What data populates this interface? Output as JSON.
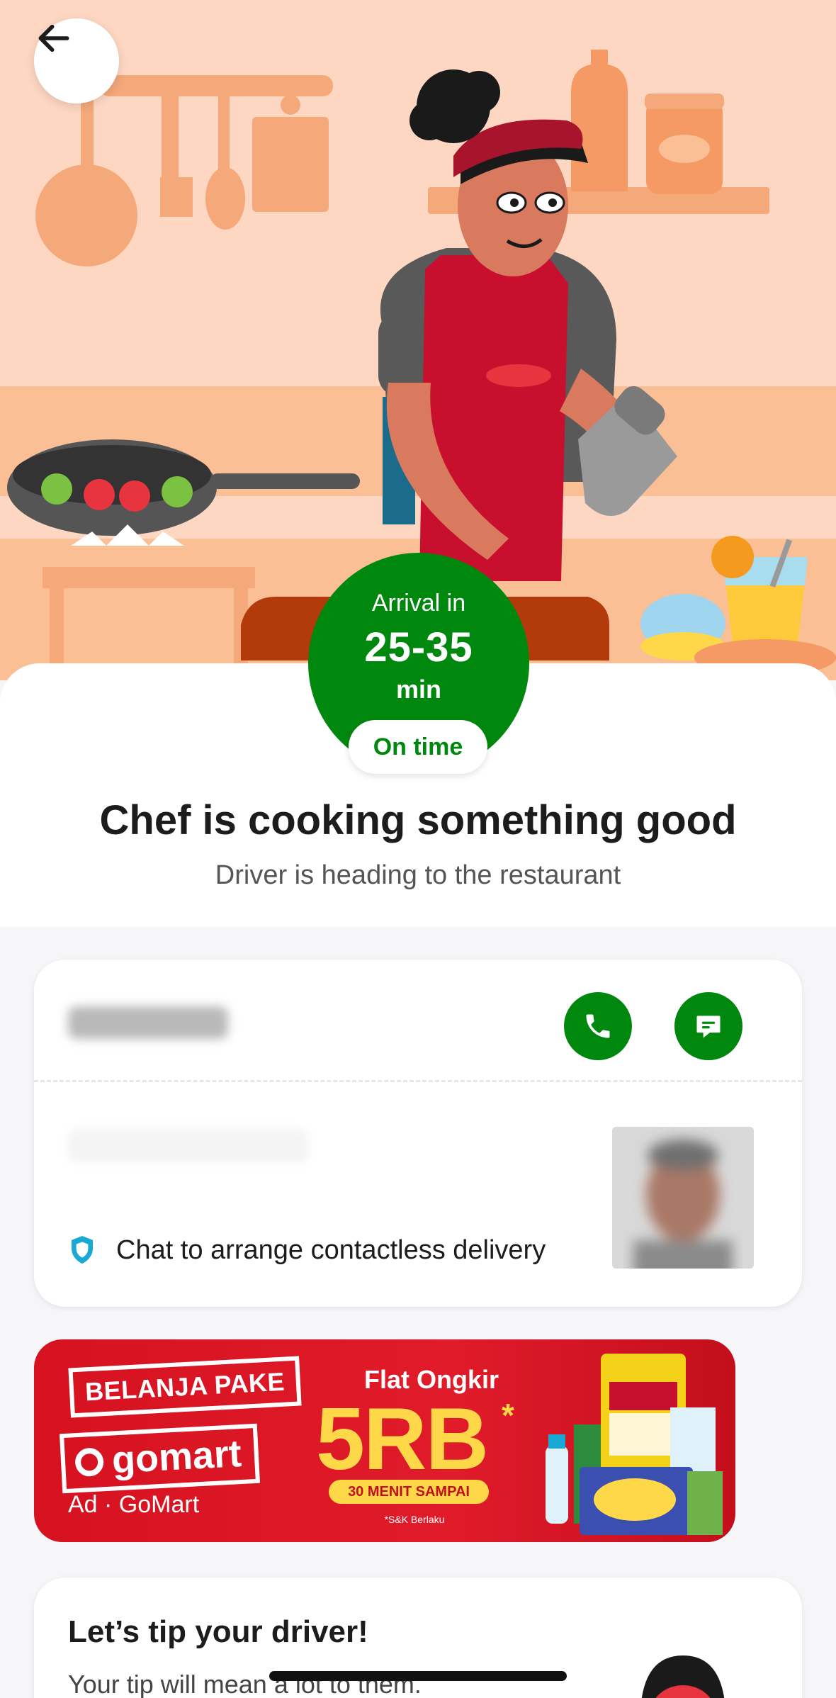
{
  "header": {
    "back_icon": "arrow-left-icon"
  },
  "eta": {
    "label": "Arrival in",
    "value": "25-35",
    "unit": "min",
    "status": "On time"
  },
  "status": {
    "title": "Chef is cooking something good",
    "subtitle": "Driver is heading to the restaurant"
  },
  "driver": {
    "call_icon": "phone-icon",
    "chat_icon": "chat-icon",
    "contactless_icon": "shield-icon",
    "contactless_text": "Chat to arrange contactless delivery"
  },
  "ad": {
    "headline_1": "BELANJA PAKE",
    "brand": "gomart",
    "label": "Ad · GoMart",
    "flat": "Flat Ongkir",
    "price": "5RB",
    "price_star": "*",
    "time_badge": "30 MENIT SAMPAI",
    "terms": "*S&K Berlaku"
  },
  "tip": {
    "title": "Let’s tip your driver!",
    "subtitle": "Your tip will mean a lot to them."
  },
  "colors": {
    "primary_green": "#00880e",
    "hero_bg": "#fdd7c2",
    "ad_red": "#e01b2a",
    "ad_yellow": "#ffd84a"
  }
}
